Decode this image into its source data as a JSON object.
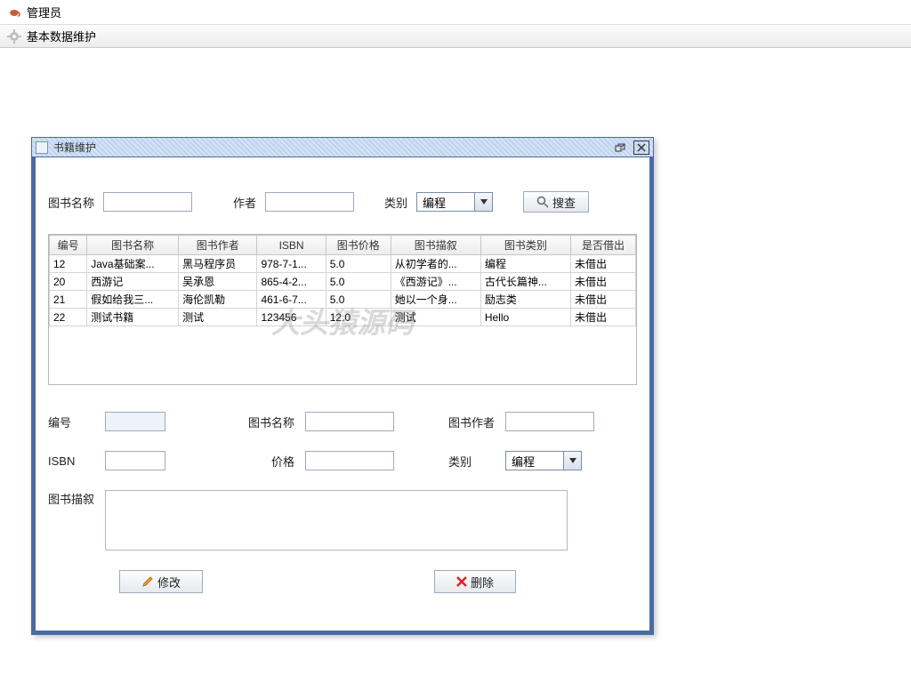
{
  "app": {
    "title": "管理员",
    "menu_item": "基本数据维护"
  },
  "frame": {
    "title": "书籍维护"
  },
  "search": {
    "name_label": "图书名称",
    "author_label": "作者",
    "category_label": "类别",
    "category_value": "编程",
    "button_label": "搜查"
  },
  "table": {
    "headers": [
      "编号",
      "图书名称",
      "图书作者",
      "ISBN",
      "图书价格",
      "图书描叙",
      "图书类别",
      "是否借出"
    ],
    "rows": [
      {
        "id": "12",
        "name": "Java基础案...",
        "author": "黑马程序员",
        "isbn": "978-7-1...",
        "price": "5.0",
        "desc": "从初学者的...",
        "category": "编程",
        "borrow": "未借出"
      },
      {
        "id": "20",
        "name": "西游记",
        "author": "吴承恩",
        "isbn": "865-4-2...",
        "price": "5.0",
        "desc": "《西游记》...",
        "category": "古代长篇神...",
        "borrow": "未借出"
      },
      {
        "id": "21",
        "name": "假如给我三...",
        "author": "海伦凯勒",
        "isbn": "461-6-7...",
        "price": "5.0",
        "desc": "她以一个身...",
        "category": "励志类",
        "borrow": "未借出"
      },
      {
        "id": "22",
        "name": "测试书籍",
        "author": "测试",
        "isbn": "123456",
        "price": "12.0",
        "desc": "测试",
        "category": "Hello",
        "borrow": "未借出"
      }
    ]
  },
  "form": {
    "id_label": "编号",
    "name_label": "图书名称",
    "author_label": "图书作者",
    "isbn_label": "ISBN",
    "price_label": "价格",
    "category_label": "类别",
    "category_value": "编程",
    "desc_label": "图书描叙"
  },
  "buttons": {
    "modify": "修改",
    "delete": "删除"
  },
  "watermark": "大头猿源码"
}
